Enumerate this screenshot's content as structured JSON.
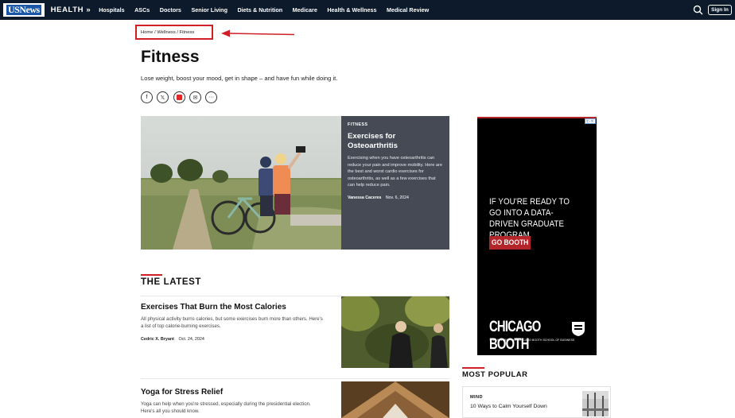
{
  "nav": {
    "logo": "USNews",
    "section": "HEALTH »",
    "items": [
      "Hospitals",
      "ASCs",
      "Doctors",
      "Senior Living",
      "Diets & Nutrition",
      "Medicare",
      "Health & Wellness",
      "Medical Review"
    ],
    "signin": "Sign In"
  },
  "breadcrumb": {
    "items": [
      "Home",
      "Wellness",
      "Fitness"
    ],
    "separator": " / "
  },
  "page": {
    "title": "Fitness",
    "subtitle": "Lose weight, boost your mood, get in shape – and have fun while doing it."
  },
  "share": [
    {
      "icon": "facebook-icon",
      "glyph": "f"
    },
    {
      "icon": "x-icon",
      "glyph": "𝕏"
    },
    {
      "icon": "flipboard-icon",
      "glyph": "F"
    },
    {
      "icon": "email-icon",
      "glyph": "✉"
    },
    {
      "icon": "more-icon",
      "glyph": "···"
    }
  ],
  "feature": {
    "tag": "FITNESS",
    "title": "Exercises for Osteoarthritis",
    "description": "Exercising when you have osteoarthritis can reduce your pain and improve mobility. Here are the best and worst cardio exercises for osteoarthritis, as well as a few exercises that can help reduce pain.",
    "author": "Vanessa Caceres",
    "date": "Nov. 6, 2024"
  },
  "latest": {
    "heading": "THE LATEST",
    "articles": [
      {
        "title": "Exercises That Burn the Most Calories",
        "description": "All physical activity burns calories, but some exercises burn more than others. Here's a list of top calorie-burning exercises.",
        "author": "Cedric X. Bryant",
        "date": "Oct. 24, 2024"
      },
      {
        "title": "Yoga for Stress Relief",
        "description": "Yoga can help when you're stressed, especially during the presidential election. Here's all you should know.",
        "author": "",
        "date": ""
      }
    ]
  },
  "ad": {
    "badge": "i▷✕",
    "headline": "IF YOU'RE READY TO GO INTO A DATA-DRIVEN GRADUATE PROGRAM",
    "cta": "GO BOOTH",
    "brand": "CHICAGO BOOTH",
    "brand_sub": "THE UNIVERSITY OF CHICAGO BOOTH SCHOOL OF BUSINESS"
  },
  "most_popular": {
    "heading": "MOST POPULAR",
    "tag": "MIND",
    "item": "10 Ways to Calm Yourself Down"
  },
  "colors": {
    "nav_bg": "#0c1a2b",
    "accent_red": "#d11f26",
    "feature_card_bg": "#454a55",
    "logo_blue": "#1a56a8"
  }
}
